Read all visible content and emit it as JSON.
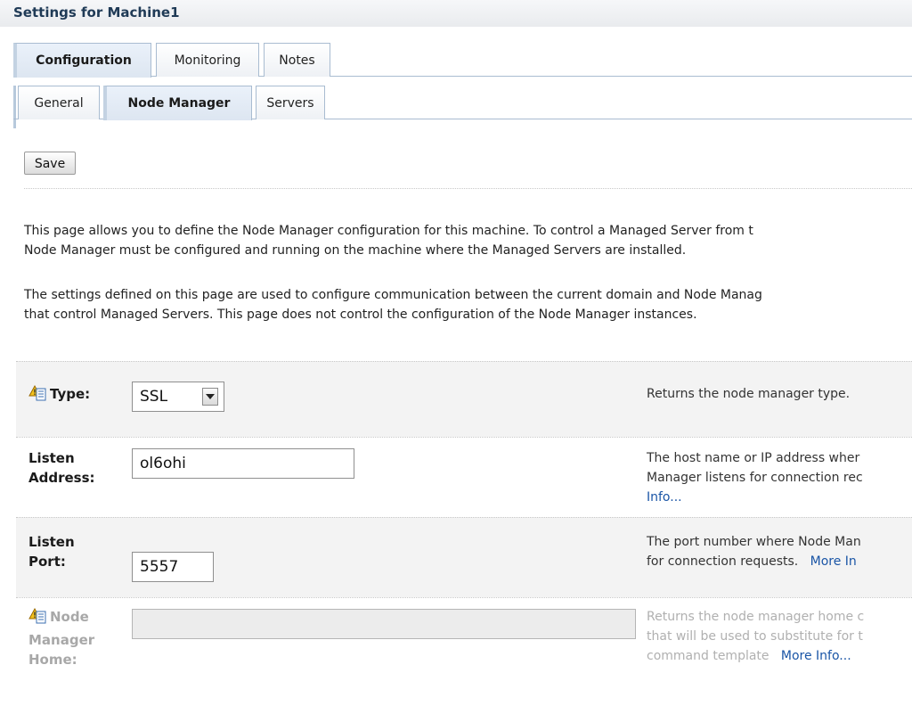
{
  "page": {
    "title": "Settings for Machine1"
  },
  "tabs_primary": [
    {
      "label": "Configuration",
      "active": true
    },
    {
      "label": "Monitoring",
      "active": false
    },
    {
      "label": "Notes",
      "active": false
    }
  ],
  "tabs_secondary": [
    {
      "label": "General",
      "active": false
    },
    {
      "label": "Node Manager",
      "active": true
    },
    {
      "label": "Servers",
      "active": false
    }
  ],
  "toolbar": {
    "save_label": "Save"
  },
  "description": {
    "p1_line1": "This page allows you to define the Node Manager configuration for this machine. To control a Managed Server from t",
    "p1_line2": "Node Manager must be configured and running on the machine where the Managed Servers are installed.",
    "p2_line1": "The settings defined on this page are used to configure communication between the current domain and Node Manag",
    "p2_line2": "that control Managed Servers. This page does not control the configuration of the Node Manager instances."
  },
  "fields": {
    "type": {
      "label": "Type:",
      "value": "SSL",
      "help_line1": "Returns the node manager type.",
      "icon": "config-warning-icon"
    },
    "listen_address": {
      "label_line1": "Listen",
      "label_line2": "Address:",
      "value": "ol6ohi",
      "help_line1": "The host name or IP address wher",
      "help_line2": "Manager listens for connection rec",
      "help_link": "Info..."
    },
    "listen_port": {
      "label_line1": "Listen",
      "label_line2": "Port:",
      "value": "5557",
      "help_line1": "The port number where Node Man",
      "help_line2_text": "for connection requests.",
      "help_link": "More In"
    },
    "node_manager_home": {
      "label_line1": "Node",
      "label_line2": "Manager",
      "label_line3": "Home:",
      "value": "",
      "help_line1": "Returns the node manager home c",
      "help_line2": "that will be used to substitute for t",
      "help_line3_text": "command template",
      "help_link": "More Info...",
      "icon": "config-warning-icon"
    }
  },
  "colors": {
    "title_text": "#1f3a56",
    "tab_border": "#a9bcd1",
    "link": "#1a55a6",
    "row_shade": "#f3f3f3"
  }
}
